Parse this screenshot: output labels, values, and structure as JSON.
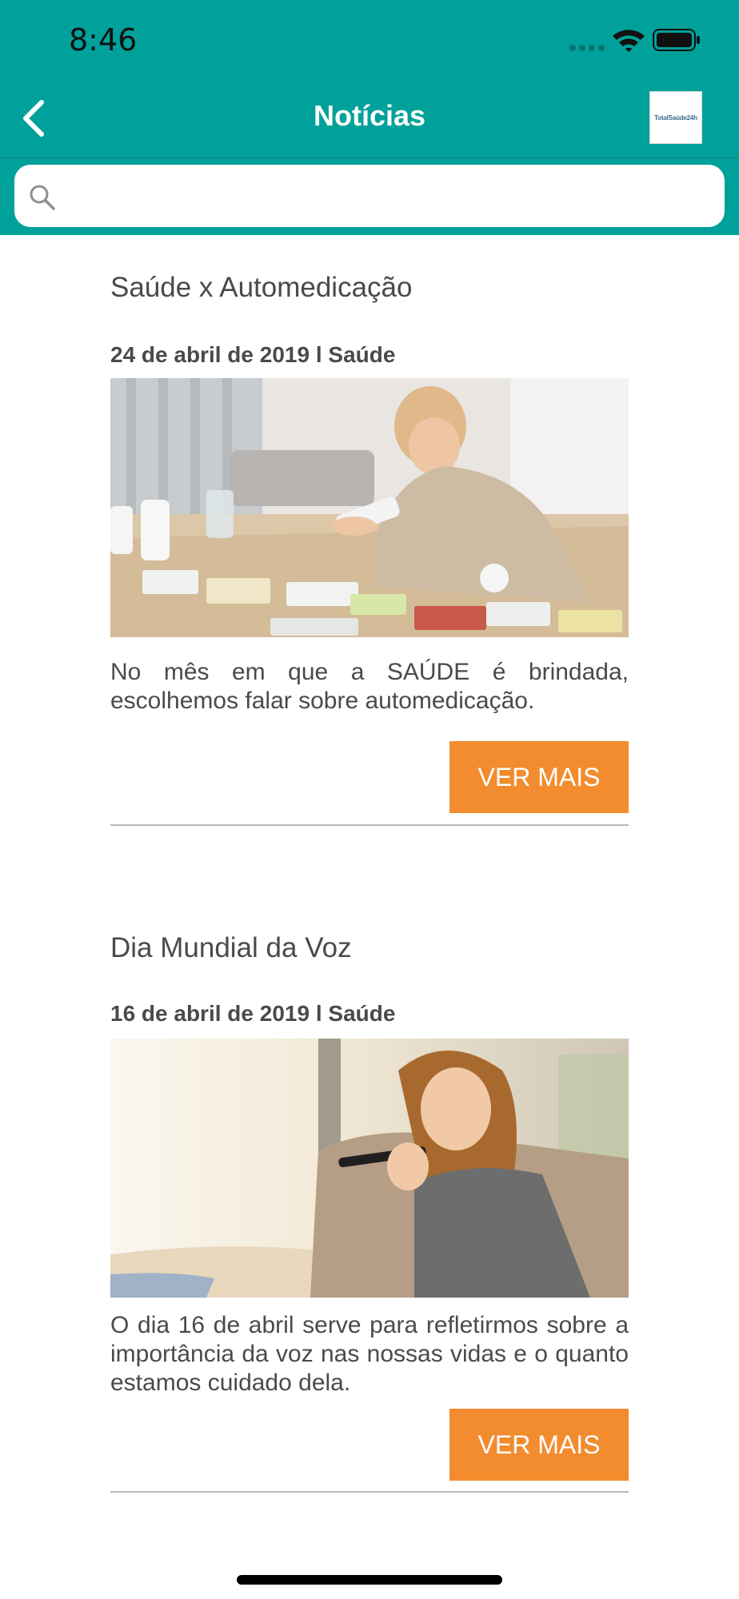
{
  "status_bar": {
    "time": "8:46",
    "icons": [
      "signal-icon",
      "wifi-icon",
      "battery-icon"
    ]
  },
  "nav": {
    "title": "Notícias",
    "back_icon": "chevron-left-icon",
    "logo_text": "TotalSaúde24h"
  },
  "search": {
    "value": "",
    "placeholder": "",
    "icon": "search-icon"
  },
  "colors": {
    "header": "#00a19a",
    "button": "#f28c2e",
    "divider": "#b9b9b9",
    "text": "#4a4a4a"
  },
  "articles": [
    {
      "title": "Saúde x Automedicação",
      "date": "24 de abril de 2019",
      "separator": "l",
      "category": "Saúde",
      "image_subject": "woman-with-pills-image",
      "text": "No mês em que a SAÚDE é brindada, escolhemos falar sobre automedicação.",
      "button_label": "VER MAIS"
    },
    {
      "title": "Dia Mundial da Voz",
      "date": "16 de abril de 2019",
      "separator": "l",
      "category": "Saúde",
      "image_subject": "woman-speaking-phone-image",
      "text": "O dia 16 de abril serve para refletirmos sobre a importância da voz nas nossas vidas e o quanto estamos cuidado dela.",
      "button_label": "VER MAIS"
    }
  ]
}
